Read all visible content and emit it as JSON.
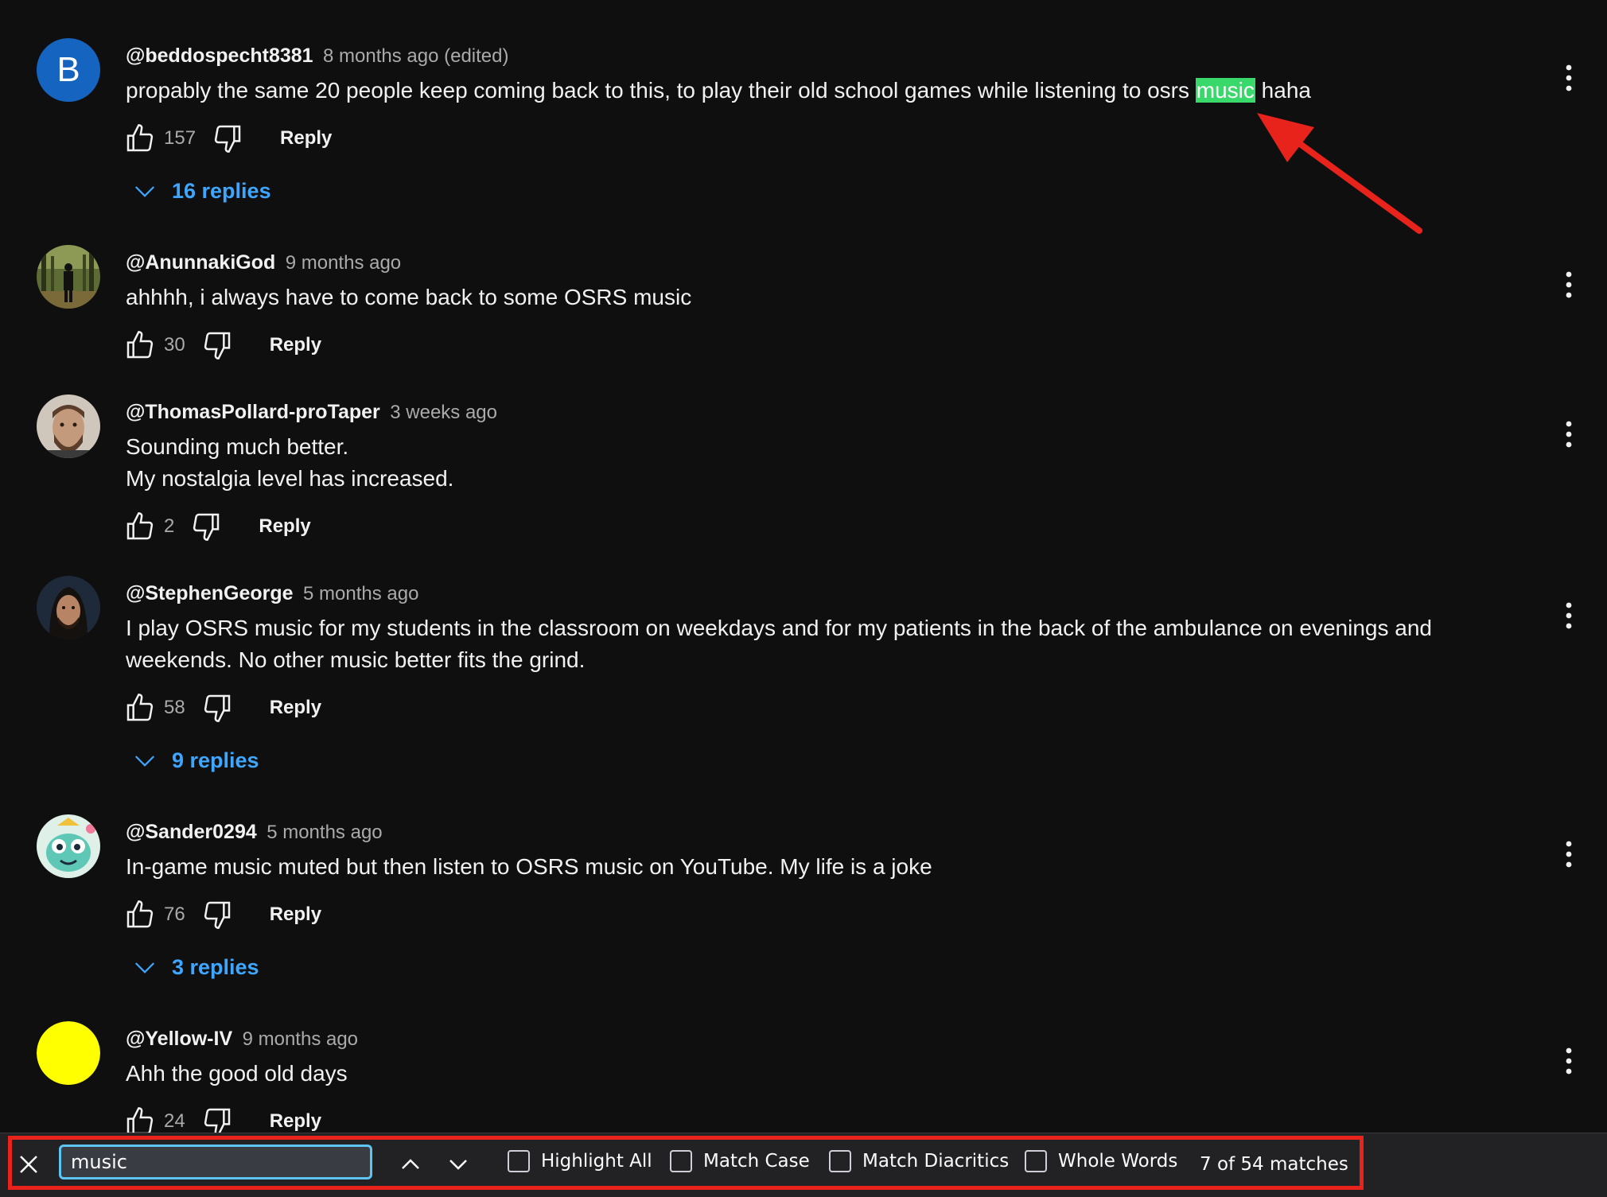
{
  "colors": {
    "background": "#0f0f0f",
    "link": "#3ea6ff",
    "highlight": "#38d96a",
    "annotation": "#e8231b"
  },
  "comments": [
    {
      "avatar": {
        "type": "letter",
        "letter": "B",
        "color": "#1565c0"
      },
      "author": "@beddospecht8381",
      "time": "8 months ago (edited)",
      "text_before": "propably the same 20 people keep coming back to this, to play their old school games while listening to osrs ",
      "text_match": "music",
      "text_after": " haha",
      "likes": "157",
      "reply_label": "Reply",
      "replies_label": "16 replies"
    },
    {
      "avatar": {
        "type": "photo",
        "scene": "figure-in-forest"
      },
      "author": "@AnunnakiGod",
      "time": "9 months ago",
      "lines": [
        "ahhhh, i always have to come back to some OSRS music"
      ],
      "likes": "30",
      "reply_label": "Reply"
    },
    {
      "avatar": {
        "type": "photo",
        "scene": "bearded-man"
      },
      "author": "@ThomasPollard-proTaper",
      "time": "3 weeks ago",
      "lines": [
        "Sounding much better.",
        "My nostalgia level has increased."
      ],
      "likes": "2",
      "reply_label": "Reply"
    },
    {
      "avatar": {
        "type": "photo",
        "scene": "man-long-hair"
      },
      "author": "@StephenGeorge",
      "time": "5 months ago",
      "lines": [
        "I play OSRS music for my students in the classroom on weekdays and for my patients in the back of the ambulance on evenings and",
        "weekends. No other music better fits the grind."
      ],
      "likes": "58",
      "reply_label": "Reply",
      "replies_label": "9 replies"
    },
    {
      "avatar": {
        "type": "photo",
        "scene": "cartoon-character"
      },
      "author": "@Sander0294",
      "time": "5 months ago",
      "lines": [
        "In-game music muted but then listen to OSRS music on YouTube. My life is a joke"
      ],
      "likes": "76",
      "reply_label": "Reply",
      "replies_label": "3 replies"
    },
    {
      "avatar": {
        "type": "solid",
        "color": "#ffff00"
      },
      "author": "@Yellow-IV",
      "time": "9 months ago",
      "lines": [
        "Ahh the good old days"
      ],
      "likes": "24",
      "reply_label": "Reply"
    }
  ],
  "find_bar": {
    "query": "music",
    "options": [
      {
        "label": "Highlight All",
        "checked": false
      },
      {
        "label": "Match Case",
        "checked": false
      },
      {
        "label": "Match Diacritics",
        "checked": false
      },
      {
        "label": "Whole Words",
        "checked": false
      }
    ],
    "status": "7 of 54 matches"
  },
  "icons": {
    "like": "thumbs-up-icon",
    "dislike": "thumbs-down-icon",
    "more": "more-vertical-icon",
    "expand": "chevron-down-icon",
    "close": "close-icon",
    "previous": "chevron-up-icon",
    "next": "chevron-down-icon"
  }
}
